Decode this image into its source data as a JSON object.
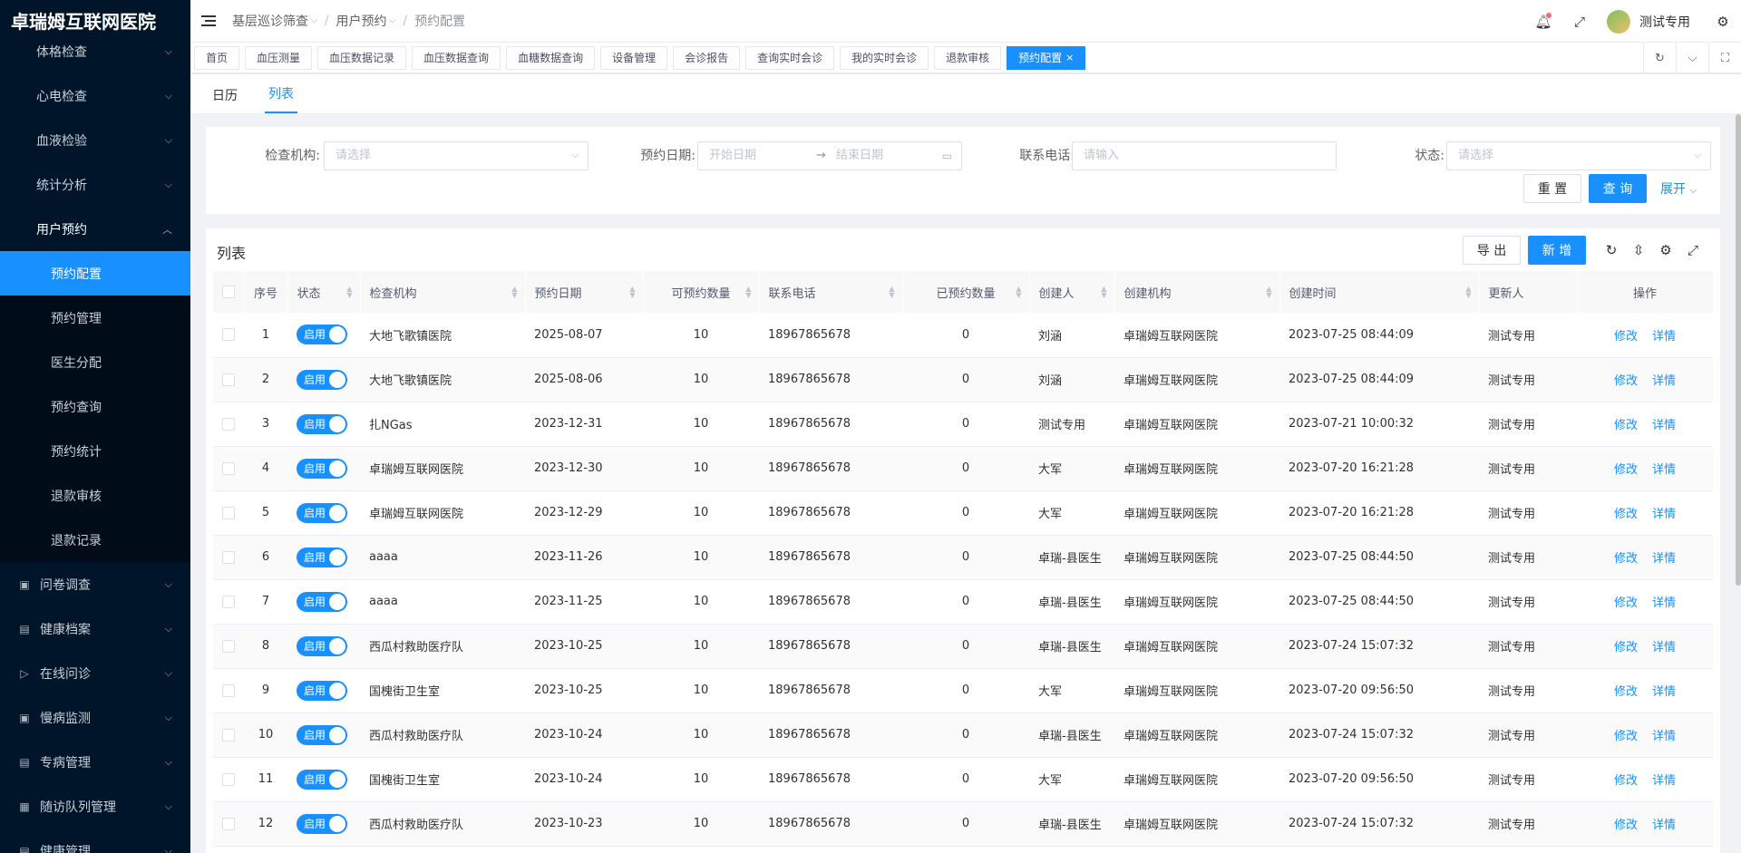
{
  "app": {
    "title": "卓瑞姆互联网医院"
  },
  "sidebar": {
    "top_items": [
      {
        "label": "体格检查"
      },
      {
        "label": "心电检查"
      },
      {
        "label": "血液检验"
      },
      {
        "label": "统计分析"
      }
    ],
    "open_parent": {
      "label": "用户预约"
    },
    "sub_items": [
      {
        "label": "预约配置",
        "active": true
      },
      {
        "label": "预约管理"
      },
      {
        "label": "医生分配"
      },
      {
        "label": "预约查询"
      },
      {
        "label": "预约统计"
      },
      {
        "label": "退款审核"
      },
      {
        "label": "退款记录"
      }
    ],
    "bottom_items": [
      {
        "label": "问卷调查"
      },
      {
        "label": "健康档案"
      },
      {
        "label": "在线问诊"
      },
      {
        "label": "慢病监测"
      },
      {
        "label": "专病管理"
      },
      {
        "label": "随访队列管理"
      },
      {
        "label": "健康管理"
      }
    ]
  },
  "header": {
    "breadcrumb": [
      "基层巡诊筛查",
      "用户预约",
      "预约配置"
    ],
    "username": "测试专用"
  },
  "tabs": [
    "首页",
    "血压测量",
    "血压数据记录",
    "血压数据查询",
    "血糖数据查询",
    "设备管理",
    "会诊报告",
    "查询实时会诊",
    "我的实时会诊",
    "退款审核",
    "预约配置"
  ],
  "active_tab": "预约配置",
  "subtabs": {
    "calendar": "日历",
    "list": "列表"
  },
  "filters": {
    "org_label": "检查机构:",
    "org_placeholder": "请选择",
    "date_label": "预约日期:",
    "date_start": "开始日期",
    "date_end": "结束日期",
    "phone_label": "联系电话:",
    "phone_placeholder": "请输入",
    "status_label": "状态:",
    "status_placeholder": "请选择",
    "reset": "重 置",
    "search": "查 询",
    "expand": "展开"
  },
  "table": {
    "title": "列表",
    "export": "导 出",
    "add": "新 增",
    "headers": [
      "序号",
      "状态",
      "检查机构",
      "预约日期",
      "可预约数量",
      "联系电话",
      "已预约数量",
      "创建人",
      "创建机构",
      "创建时间",
      "更新人",
      "操作"
    ],
    "switch_label": "启用",
    "edit": "修改",
    "detail": "详情",
    "rows": [
      [
        "1",
        "大地飞歌镇医院",
        "2025-08-07",
        "10",
        "18967865678",
        "0",
        "刘涵",
        "卓瑞姆互联网医院",
        "2023-07-25 08:44:09",
        "测试专用"
      ],
      [
        "2",
        "大地飞歌镇医院",
        "2025-08-06",
        "10",
        "18967865678",
        "0",
        "刘涵",
        "卓瑞姆互联网医院",
        "2023-07-25 08:44:09",
        "测试专用"
      ],
      [
        "3",
        "扎NGas",
        "2023-12-31",
        "10",
        "18967865678",
        "0",
        "测试专用",
        "卓瑞姆互联网医院",
        "2023-07-21 10:00:32",
        "测试专用"
      ],
      [
        "4",
        "卓瑞姆互联网医院",
        "2023-12-30",
        "10",
        "18967865678",
        "0",
        "大军",
        "卓瑞姆互联网医院",
        "2023-07-20 16:21:28",
        "测试专用"
      ],
      [
        "5",
        "卓瑞姆互联网医院",
        "2023-12-29",
        "10",
        "18967865678",
        "0",
        "大军",
        "卓瑞姆互联网医院",
        "2023-07-20 16:21:28",
        "测试专用"
      ],
      [
        "6",
        "aaaa",
        "2023-11-26",
        "10",
        "18967865678",
        "0",
        "卓瑞-县医生",
        "卓瑞姆互联网医院",
        "2023-07-25 08:44:50",
        "测试专用"
      ],
      [
        "7",
        "aaaa",
        "2023-11-25",
        "10",
        "18967865678",
        "0",
        "卓瑞-县医生",
        "卓瑞姆互联网医院",
        "2023-07-25 08:44:50",
        "测试专用"
      ],
      [
        "8",
        "西瓜村救助医疗队",
        "2023-10-25",
        "10",
        "18967865678",
        "0",
        "卓瑞-县医生",
        "卓瑞姆互联网医院",
        "2023-07-24 15:07:32",
        "测试专用"
      ],
      [
        "9",
        "国槐街卫生室",
        "2023-10-25",
        "10",
        "18967865678",
        "0",
        "大军",
        "卓瑞姆互联网医院",
        "2023-07-20 09:56:50",
        "测试专用"
      ],
      [
        "10",
        "西瓜村救助医疗队",
        "2023-10-24",
        "10",
        "18967865678",
        "0",
        "卓瑞-县医生",
        "卓瑞姆互联网医院",
        "2023-07-24 15:07:32",
        "测试专用"
      ],
      [
        "11",
        "国槐街卫生室",
        "2023-10-24",
        "10",
        "18967865678",
        "0",
        "大军",
        "卓瑞姆互联网医院",
        "2023-07-20 09:56:50",
        "测试专用"
      ],
      [
        "12",
        "西瓜村救助医疗队",
        "2023-10-23",
        "10",
        "18967865678",
        "0",
        "卓瑞-县医生",
        "卓瑞姆互联网医院",
        "2023-07-24 15:07:32",
        "测试专用"
      ]
    ]
  },
  "colors": {
    "primary": "#1890ff",
    "sidebar_bg": "#001529"
  }
}
